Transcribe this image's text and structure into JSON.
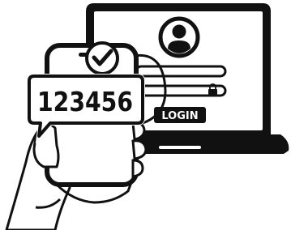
{
  "otp": {
    "code": "123456"
  },
  "login_form": {
    "button_label": "LOGIN"
  },
  "icons": {
    "verified": "check-circle-icon",
    "user": "user-avatar-icon",
    "lock": "lock-icon"
  },
  "colors": {
    "ink": "#111111",
    "paper": "#ffffff"
  }
}
